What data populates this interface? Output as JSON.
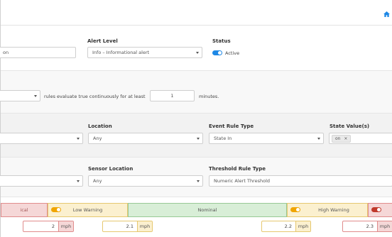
{
  "colors": {
    "accent": "#1e88e5",
    "toggle_on": "#1e88e5",
    "toggle_warning": "#f0a500",
    "toggle_critical": "#c0392b"
  },
  "header": {
    "home_icon": "home-icon"
  },
  "alert": {
    "name_value": "on",
    "level_label": "Alert Level",
    "level_value": "Info – Informational alert",
    "status_label": "Status",
    "status_value": "Active"
  },
  "rules": {
    "prefix_text": "rules evaluate true continuously for at least",
    "duration_value": "1",
    "suffix_text": "minutes."
  },
  "event_rule": {
    "location_label": "Location",
    "location_value": "Any",
    "rule_type_label": "Event Rule Type",
    "rule_type_value": "State In",
    "state_values_label": "State Value(s)",
    "state_tag": "on",
    "state_tag_remove": "×"
  },
  "threshold_rule": {
    "sensor_location_label": "Sensor Location",
    "sensor_location_value": "Any",
    "rule_type_label": "Threshold Rule Type",
    "rule_type_value": "Numeric Alert Threshold"
  },
  "bands": {
    "critical_low": "ical",
    "low_warning": "Low Warning",
    "nominal": "Nominal",
    "high_warning": "High Warning"
  },
  "thresholds": [
    {
      "value": "2",
      "unit": "mph"
    },
    {
      "value": "2.1",
      "unit": "mph"
    },
    {
      "value": "2.2",
      "unit": "mph"
    },
    {
      "value": "2.3",
      "unit": "mph"
    }
  ]
}
